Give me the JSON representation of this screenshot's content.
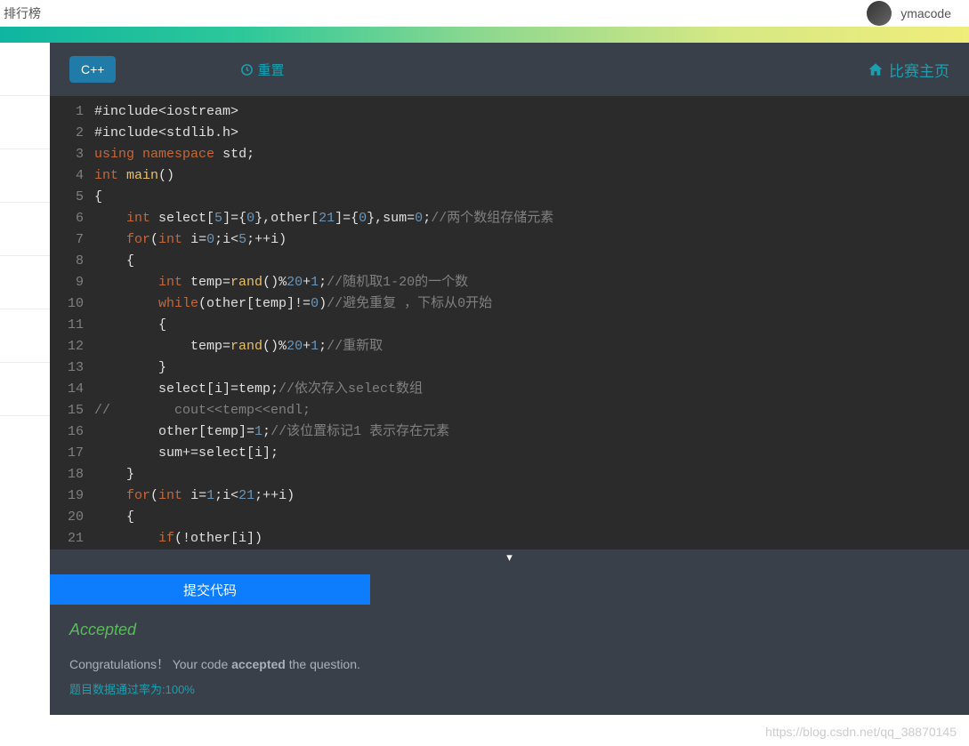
{
  "header": {
    "left_text": "排行榜",
    "username": "ymacode"
  },
  "toolbar": {
    "lang_label": "C++",
    "reset_label": "重置",
    "home_label": "比赛主页"
  },
  "code_lines": [
    {
      "n": "1",
      "h": "<span class='str'>#include&lt;iostream&gt;</span>"
    },
    {
      "n": "2",
      "h": "<span class='str'>#include&lt;stdlib.h&gt;</span>"
    },
    {
      "n": "3",
      "h": "<span class='kw'>using</span> <span class='kw'>namespace</span> <span class='str'>std;</span>"
    },
    {
      "n": "4",
      "h": "<span class='kw'>int</span> <span class='fn'>main</span>()"
    },
    {
      "n": "5",
      "h": "{"
    },
    {
      "n": "6",
      "h": "    <span class='kw'>int</span> select[<span class='num'>5</span>]={<span class='num'>0</span>},other[<span class='num'>21</span>]={<span class='num'>0</span>},sum=<span class='num'>0</span>;<span class='cm'>//两个数组存储元素</span>"
    },
    {
      "n": "7",
      "h": "    <span class='kw'>for</span>(<span class='kw'>int</span> i=<span class='num'>0</span>;i&lt;<span class='num'>5</span>;++i)"
    },
    {
      "n": "8",
      "h": "    {"
    },
    {
      "n": "9",
      "h": "        <span class='kw'>int</span> temp=<span class='fn'>rand</span>()%<span class='num'>20</span>+<span class='num'>1</span>;<span class='cm'>//随机取1-20的一个数</span>"
    },
    {
      "n": "10",
      "h": "        <span class='kw'>while</span>(other[temp]!=<span class='num'>0</span>)<span class='cm'>//避免重复 ，下标从0开始</span>"
    },
    {
      "n": "11",
      "h": "        {"
    },
    {
      "n": "12",
      "h": "            temp=<span class='fn'>rand</span>()%<span class='num'>20</span>+<span class='num'>1</span>;<span class='cm'>//重新取</span>"
    },
    {
      "n": "13",
      "h": "        }"
    },
    {
      "n": "14",
      "h": "        select[i]=temp;<span class='cm'>//依次存入select数组</span>"
    },
    {
      "n": "15",
      "h": "<span class='cm'>//        cout&lt;&lt;temp&lt;&lt;endl;</span>"
    },
    {
      "n": "16",
      "h": "        other[temp]=<span class='num'>1</span>;<span class='cm'>//该位置标记1 表示存在元素</span>"
    },
    {
      "n": "17",
      "h": "        sum+=select[i];"
    },
    {
      "n": "18",
      "h": "    }"
    },
    {
      "n": "19",
      "h": "    <span class='kw'>for</span>(<span class='kw'>int</span> i=<span class='num'>1</span>;i&lt;<span class='num'>21</span>;++i)"
    },
    {
      "n": "20",
      "h": "    {"
    },
    {
      "n": "21",
      "h": "        <span class='kw'>if</span>(!other[i])"
    }
  ],
  "submit": {
    "label": "提交代码"
  },
  "result": {
    "status": "Accepted",
    "congrats_pre": "Congratulations！ Your code ",
    "congrats_bold": "accepted",
    "congrats_post": " the question.",
    "passrate": "题目数据通过率为:100%"
  },
  "watermark": "https://blog.csdn.net/qq_38870145"
}
